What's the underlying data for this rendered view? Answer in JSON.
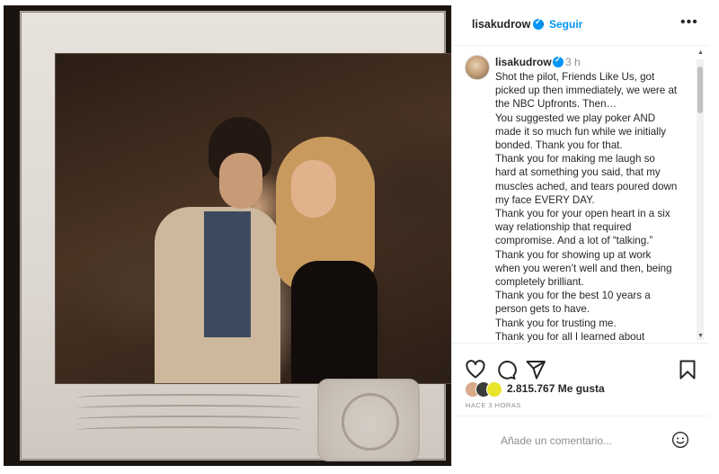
{
  "post": {
    "username": "lisakudrow",
    "follow_label": "Seguir",
    "more_label": "•••",
    "time_ago": "3 h",
    "caption_lines": [
      "Shot the pilot, Friends Like Us, got",
      "picked up then immediately, we were at",
      "the NBC Upfronts. Then…",
      "You suggested we play poker AND",
      "made it so much fun while we initially",
      "bonded. Thank you for that.",
      "Thank you for making me laugh so",
      "hard at something you said, that my",
      "muscles ached, and tears poured down",
      "my face EVERY DAY.",
      "Thank you for your open heart in a six",
      "way relationship that required",
      "compromise. And a lot of “talking.”",
      "Thank you for showing up at work",
      "when you weren’t well and then, being",
      "completely brilliant.",
      "Thank you for the best 10 years a",
      "person gets to have.",
      "Thank you for trusting me.",
      "Thank you for all I learned about"
    ],
    "likes_text": "2.815.767 Me gusta",
    "posted_ago": "HACE 3 HORAS",
    "comment_placeholder": "Añade un comentario...",
    "icons": [
      "heart-icon",
      "comment-icon",
      "share-icon",
      "bookmark-icon",
      "emoji-icon",
      "verified-icon"
    ],
    "colors": {
      "accent": "#0095f6",
      "text": "#262626",
      "muted": "#8e8e8e"
    }
  }
}
